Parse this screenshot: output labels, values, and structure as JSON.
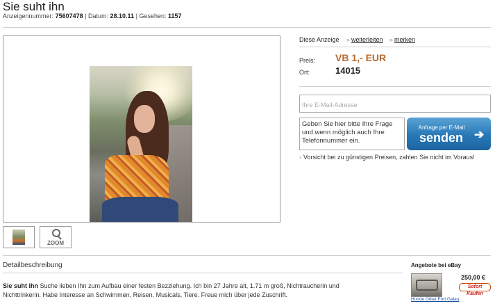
{
  "listing": {
    "title": "Sie suht ihn",
    "ad_number_label": "Anzeigennummer:",
    "ad_number": "75607478",
    "date_label": "Datum:",
    "date": "28.10.11",
    "views_label": "Gesehen:",
    "views": "1157",
    "separator": "|"
  },
  "gallery": {
    "zoom_label": "ZOOM"
  },
  "actions": {
    "intro": "Diese Anzeige",
    "forward": "weiterleiten",
    "remember": "merken"
  },
  "details": {
    "price_label": "Preis:",
    "price": "VB 1,- EUR",
    "location_label": "Ort:",
    "location": "14015"
  },
  "contact": {
    "email_placeholder": "Ihre E-Mail-Adresse",
    "message_placeholder": "Geben Sie hier bitte Ihre Frage und wenn möglich auch Ihre Telefonnummer ein.",
    "send_small": "Anfrage per E-Mail",
    "send_big": "senden",
    "warning": "Vorsicht bei zu günstigen Preisen, zahlen Sie nicht im Voraus!"
  },
  "description": {
    "heading": "Detailbeschreibung",
    "lead": "Sie suht ihn",
    "text": " Suche lieben Ihn zum Aufbau einer festen Bezziehung. Ich bin 27 Jahre alt, 1.71 m groß, Nichtraucherin und Nichttrinkerin. Habe Interesse an Schwimmen, Reisen, Musicals, Tiere. Freue mich über jede Zuschrift."
  },
  "ebay": {
    "heading": "Angebote bei eBay",
    "price": "250,00 €",
    "buy_now": "Sofort Kaufen",
    "item_link": "Hunde Gitter Fort Galau"
  },
  "colors": {
    "accent_price": "#b86a2e",
    "send_button": "#2878b6"
  }
}
